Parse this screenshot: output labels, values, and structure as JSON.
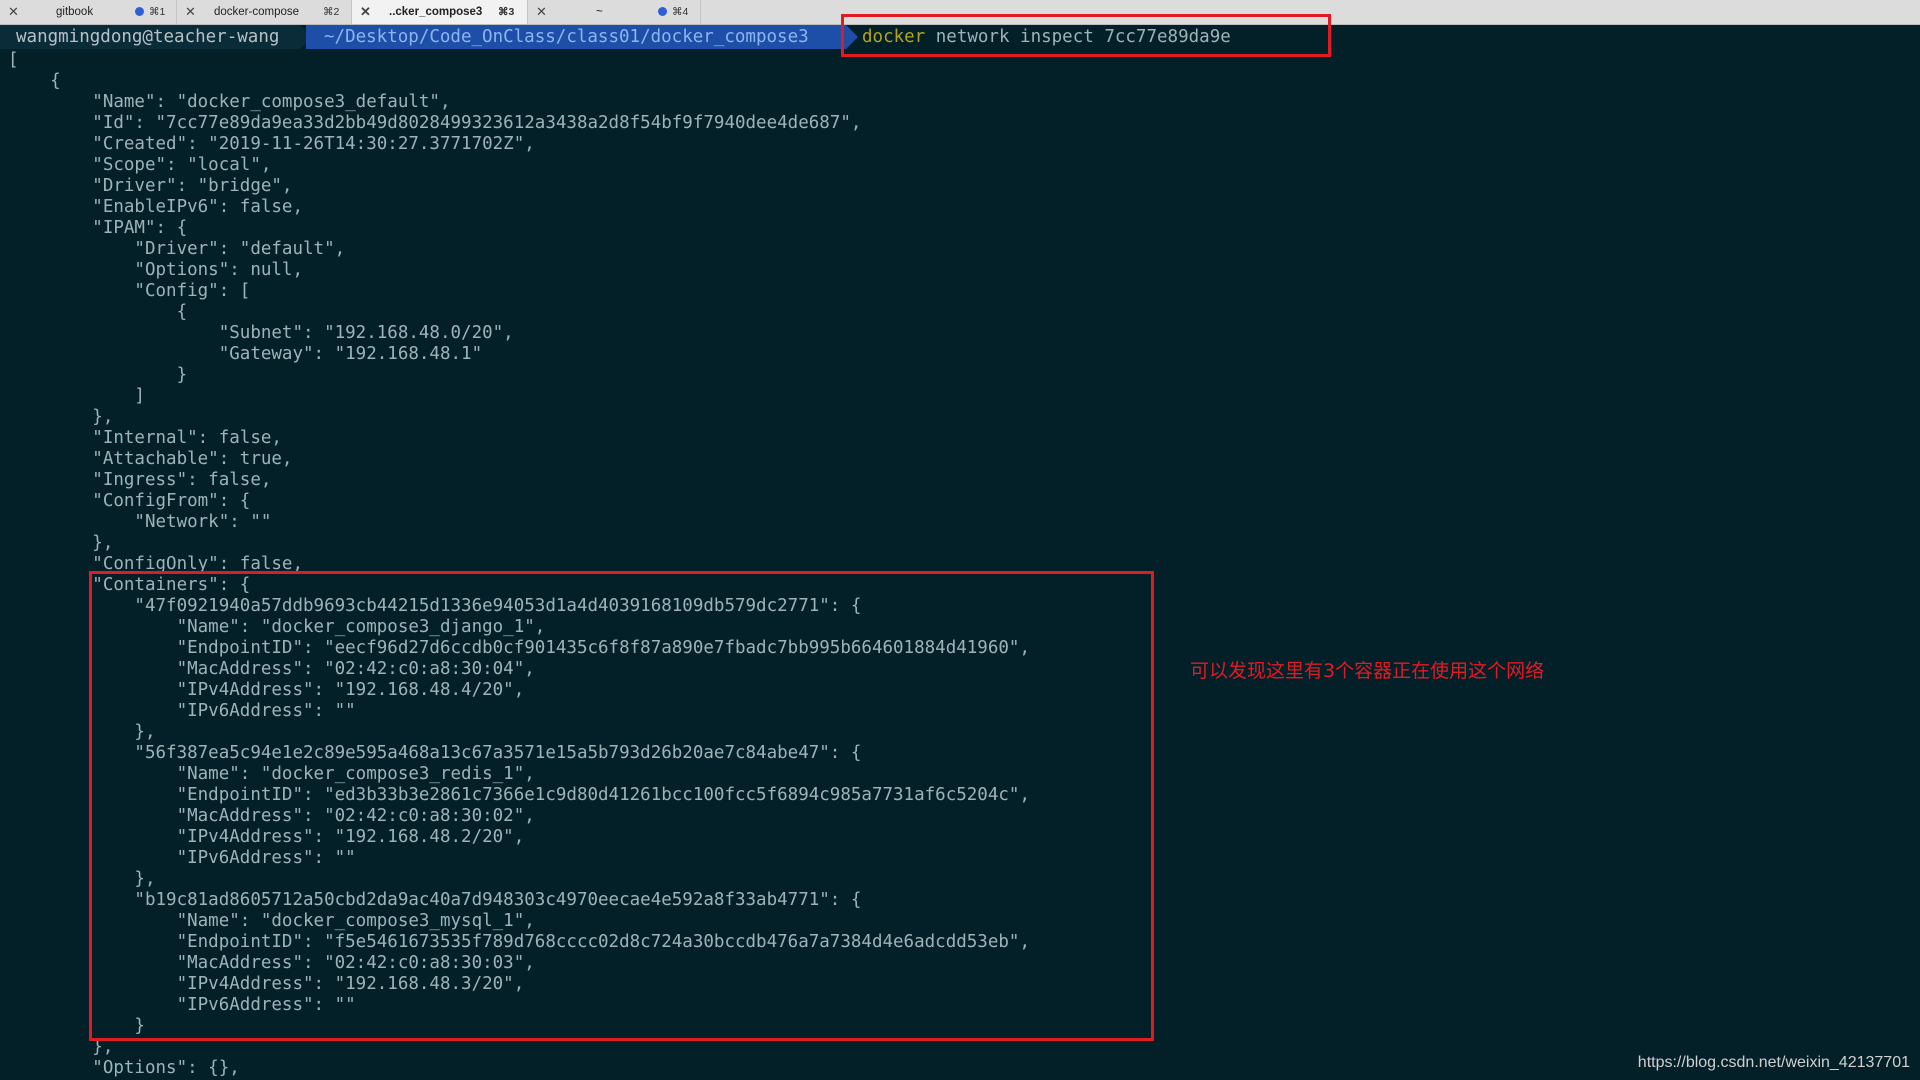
{
  "tabs": [
    {
      "title": "gitbook",
      "shortcut": "⌘1"
    },
    {
      "title": "docker-compose",
      "shortcut": "⌘2"
    },
    {
      "title": "..cker_compose3",
      "shortcut": "⌘3"
    },
    {
      "title": "~",
      "shortcut": "⌘4"
    }
  ],
  "prompt": {
    "user_host": "wangmingdong@teacher-wang",
    "path": "~/Desktop/Code_OnClass/class01/docker_compose3",
    "command_keyword": "docker",
    "command_rest": " network inspect 7cc77e89da9e"
  },
  "output_lines": [
    "[",
    "    {",
    "        \"Name\": \"docker_compose3_default\",",
    "        \"Id\": \"7cc77e89da9ea33d2bb49d8028499323612a3438a2d8f54bf9f7940dee4de687\",",
    "        \"Created\": \"2019-11-26T14:30:27.3771702Z\",",
    "        \"Scope\": \"local\",",
    "        \"Driver\": \"bridge\",",
    "        \"EnableIPv6\": false,",
    "        \"IPAM\": {",
    "            \"Driver\": \"default\",",
    "            \"Options\": null,",
    "            \"Config\": [",
    "                {",
    "                    \"Subnet\": \"192.168.48.0/20\",",
    "                    \"Gateway\": \"192.168.48.1\"",
    "                }",
    "            ]",
    "        },",
    "        \"Internal\": false,",
    "        \"Attachable\": true,",
    "        \"Ingress\": false,",
    "        \"ConfigFrom\": {",
    "            \"Network\": \"\"",
    "        },",
    "        \"ConfigOnly\": false,",
    "        \"Containers\": {",
    "            \"47f0921940a57ddb9693cb44215d1336e94053d1a4d4039168109db579dc2771\": {",
    "                \"Name\": \"docker_compose3_django_1\",",
    "                \"EndpointID\": \"eecf96d27d6ccdb0cf901435c6f8f87a890e7fbadc7bb995b664601884d41960\",",
    "                \"MacAddress\": \"02:42:c0:a8:30:04\",",
    "                \"IPv4Address\": \"192.168.48.4/20\",",
    "                \"IPv6Address\": \"\"",
    "            },",
    "            \"56f387ea5c94e1e2c89e595a468a13c67a3571e15a5b793d26b20ae7c84abe47\": {",
    "                \"Name\": \"docker_compose3_redis_1\",",
    "                \"EndpointID\": \"ed3b33b3e2861c7366e1c9d80d41261bcc100fcc5f6894c985a7731af6c5204c\",",
    "                \"MacAddress\": \"02:42:c0:a8:30:02\",",
    "                \"IPv4Address\": \"192.168.48.2/20\",",
    "                \"IPv6Address\": \"\"",
    "            },",
    "            \"b19c81ad8605712a50cbd2da9ac40a7d948303c4970eecae4e592a8f33ab4771\": {",
    "                \"Name\": \"docker_compose3_mysql_1\",",
    "                \"EndpointID\": \"f5e5461673535f789d768cccc02d8c724a30bccdb476a7a7384d4e6adcdd53eb\",",
    "                \"MacAddress\": \"02:42:c0:a8:30:03\",",
    "                \"IPv4Address\": \"192.168.48.3/20\",",
    "                \"IPv6Address\": \"\"",
    "            }",
    "        },",
    "        \"Options\": {},"
  ],
  "annotation": "可以发现这里有3个容器正在使用这个网络",
  "watermark": "https://blog.csdn.net/weixin_42137701",
  "colors": {
    "background": "#032029",
    "highlight": "#e01b24",
    "path_segment": "#1d4fa8",
    "command_keyword": "#b3a21f"
  }
}
